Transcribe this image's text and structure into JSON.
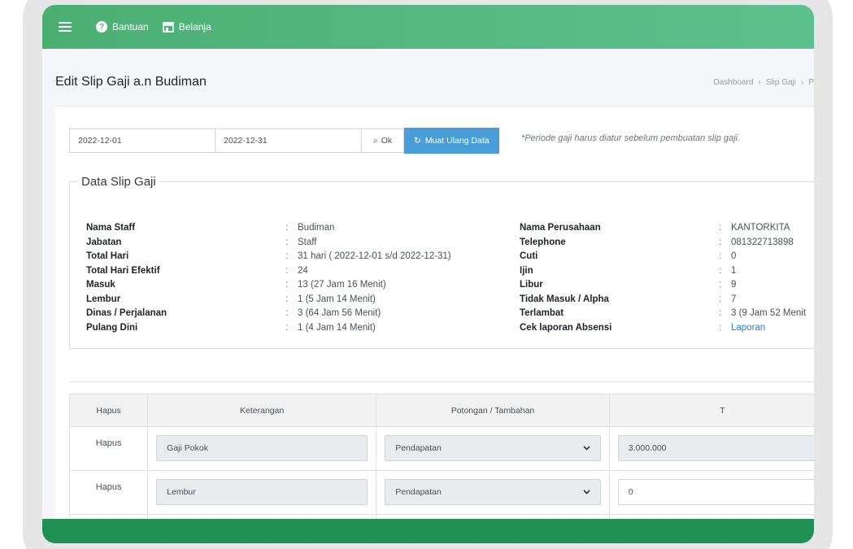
{
  "nav": {
    "help": "Bantuan",
    "shop": "Belanja"
  },
  "page": {
    "title": "Edit Slip Gaji a.n Budiman"
  },
  "breadcrumb": [
    "Dashboard",
    "›",
    "Slip Gaji",
    "›",
    "P"
  ],
  "period": {
    "start": "2022-12-01",
    "end": "2022-12-31",
    "ok": "Ok",
    "reload": "Muat Ulang Data",
    "note": "*Periode gaji harus diatur sebelum pembuatan slip gaji."
  },
  "slip": {
    "legend": "Data Slip Gaji",
    "left": [
      {
        "label": "Nama Staff",
        "value": "Budiman"
      },
      {
        "label": "Jabatan",
        "value": "Staff"
      },
      {
        "label": "Total Hari",
        "value": "31 hari ( 2022-12-01 s/d 2022-12-31)"
      },
      {
        "label": "Total Hari Efektif",
        "value": "24"
      },
      {
        "label": "Masuk",
        "value": "13 (27 Jam 16 Menit)"
      },
      {
        "label": "Lembur",
        "value": "1 (5 Jam 14 Menit)"
      },
      {
        "label": "Dinas / Perjalanan",
        "value": "3 (64 Jam 56 Menit)"
      },
      {
        "label": "Pulang Dini",
        "value": "1 (4 Jam 14 Menit)"
      }
    ],
    "right": [
      {
        "label": "Nama Perusahaan",
        "value": "KANTORKITA"
      },
      {
        "label": "Telephone",
        "value": "081322713898"
      },
      {
        "label": "Cuti",
        "value": "0"
      },
      {
        "label": "Ijin",
        "value": "1"
      },
      {
        "label": "Libur",
        "value": "9"
      },
      {
        "label": "Tidak Masuk / Alpha",
        "value": "7"
      },
      {
        "label": "Terlambat",
        "value": "3 (9 Jam 52 Menit"
      },
      {
        "label": "Cek laporan Absensi",
        "value": "Laporan"
      }
    ]
  },
  "table": {
    "headers": [
      "Hapus",
      "Keterangan",
      "Potongan / Tambahan",
      "T"
    ],
    "rows": [
      {
        "hapus": "Hapus",
        "keterangan": "Gaji Pokok",
        "tipe": "Pendapatan",
        "nilai": "3.000.000"
      },
      {
        "hapus": "Hapus",
        "keterangan": "Lembur",
        "tipe": "Pendapatan",
        "nilai": "0"
      }
    ]
  },
  "colors": {
    "navbar": "#4caf72",
    "reload_button": "#4a9ed8",
    "footer": "#1f8f52"
  }
}
